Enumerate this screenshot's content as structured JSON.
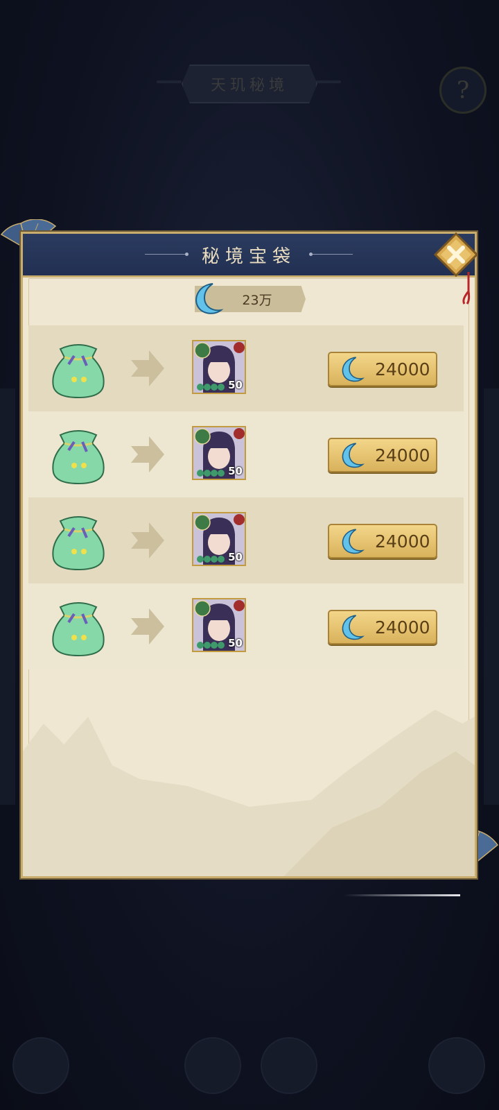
{
  "background": {
    "title": "天玑秘境",
    "help_label": "?"
  },
  "panel": {
    "title": "秘境宝袋",
    "balance": "23万",
    "rows": [
      {
        "level": "50",
        "price": "24000"
      },
      {
        "level": "50",
        "price": "24000"
      },
      {
        "level": "50",
        "price": "24000"
      },
      {
        "level": "50",
        "price": "24000"
      }
    ]
  },
  "colors": {
    "header": "#213052",
    "panel": "#efe7d2",
    "gold": "#d9b25c",
    "moon": "#5fc3ea"
  },
  "icons": {
    "currency": "crescent-moon-icon",
    "close": "close-icon",
    "bag": "green-pouch-icon",
    "arrow": "right-arrow-icon"
  }
}
